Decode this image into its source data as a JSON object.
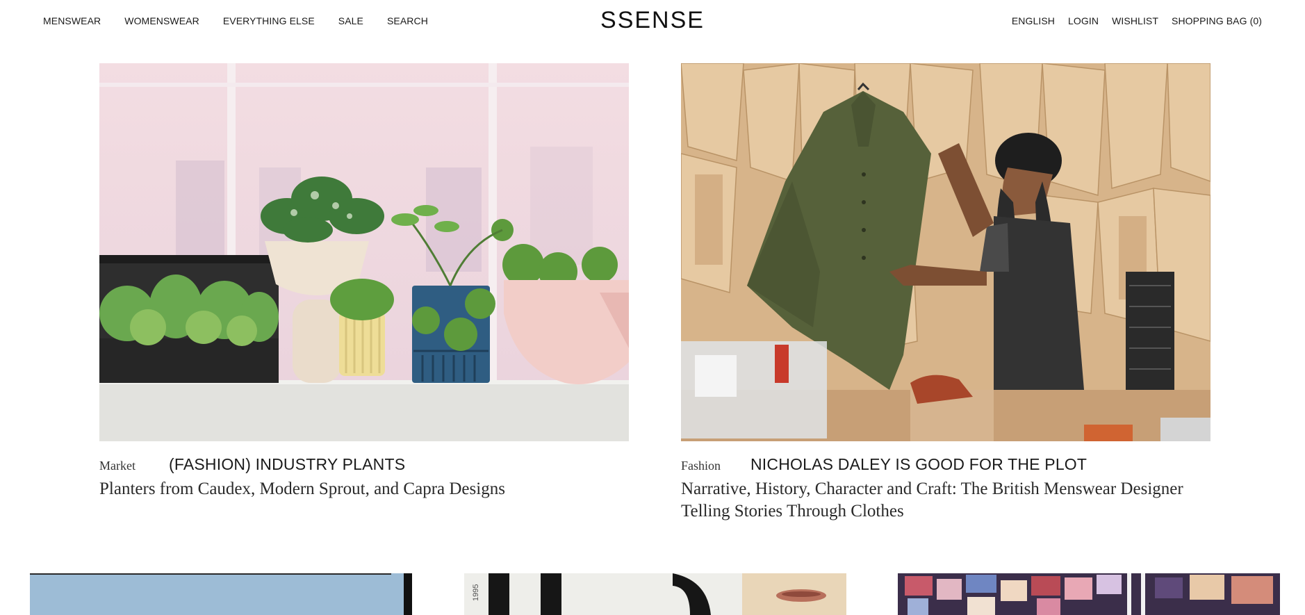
{
  "header": {
    "nav_left": [
      {
        "label": "MENSWEAR"
      },
      {
        "label": "WOMENSWEAR"
      },
      {
        "label": "EVERYTHING ELSE"
      },
      {
        "label": "SALE"
      },
      {
        "label": "SEARCH"
      }
    ],
    "logo": "SSENSE",
    "nav_right": [
      {
        "label": "ENGLISH"
      },
      {
        "label": "LOGIN"
      },
      {
        "label": "WISHLIST"
      },
      {
        "label": "SHOPPING BAG (0)"
      }
    ]
  },
  "features": [
    {
      "category": "Market",
      "title": "(FASHION) INDUSTRY PLANTS",
      "subtitle": "Planters from Caudex, Modern Sprout, and Capra Designs"
    },
    {
      "category": "Fashion",
      "title": "NICHOLAS DALEY IS GOOD FOR THE PLOT",
      "subtitle": "Narrative, History, Character and Craft: The British Menswear Designer Telling Stories Through Clothes"
    }
  ],
  "thumbnails": [
    {
      "name": "sky-photo"
    },
    {
      "name": "magazine-photo",
      "print": "1995"
    },
    {
      "name": "collage-photo"
    }
  ]
}
